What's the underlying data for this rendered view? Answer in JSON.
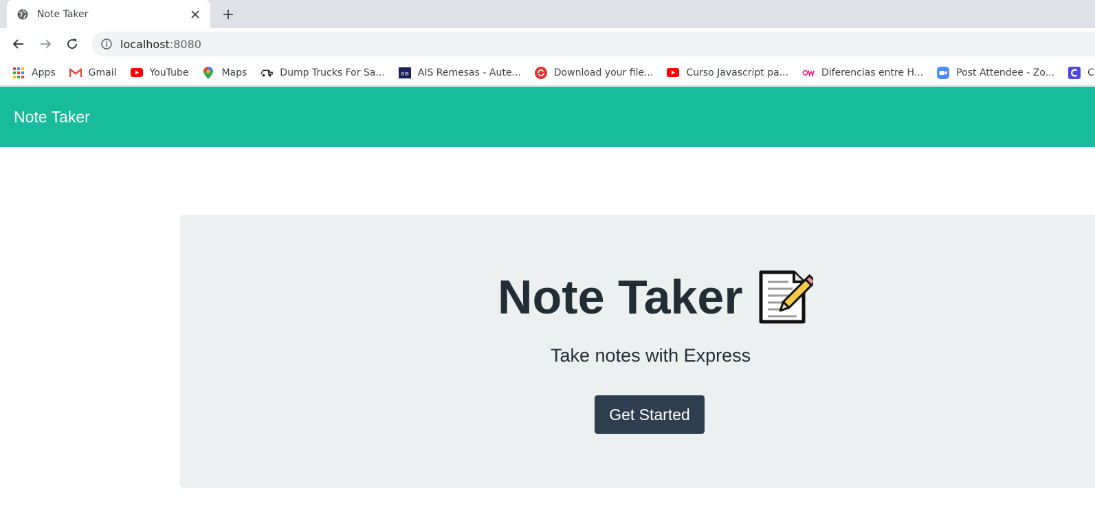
{
  "browser": {
    "tab": {
      "title": "Note Taker"
    },
    "address": {
      "host": "localhost",
      "port": ":8080"
    },
    "bookmarks": [
      {
        "label": "Apps",
        "icon": "apps-grid-icon"
      },
      {
        "label": "Gmail",
        "icon": "gmail-icon"
      },
      {
        "label": "YouTube",
        "icon": "youtube-icon"
      },
      {
        "label": "Maps",
        "icon": "maps-icon"
      },
      {
        "label": "Dump Trucks For Sa...",
        "icon": "truck-icon"
      },
      {
        "label": "AIS Remesas - Aute...",
        "icon": "ais-icon"
      },
      {
        "label": "Download your file...",
        "icon": "download-icon"
      },
      {
        "label": "Curso Javascript pa...",
        "icon": "youtube-icon"
      },
      {
        "label": "Diferencias entre H...",
        "icon": "ow-icon"
      },
      {
        "label": "Post Attendee - Zo...",
        "icon": "zoom-icon"
      },
      {
        "label": "Clev",
        "icon": "c-icon"
      }
    ]
  },
  "page": {
    "navbar": {
      "brand": "Note Taker"
    },
    "hero": {
      "title": "Note Taker",
      "subtitle": "Take notes with Express",
      "button": "Get Started"
    }
  },
  "colors": {
    "navbar": "#18bc9c",
    "jumbotron": "#ecf0f1",
    "button": "#2c3e50",
    "text": "#222d35"
  }
}
